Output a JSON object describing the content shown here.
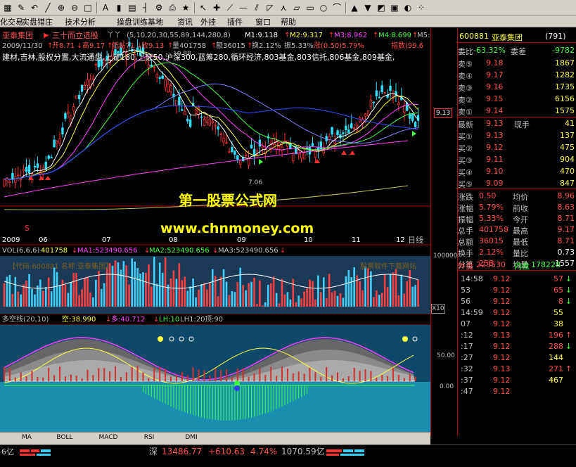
{
  "toolbar": {
    "icons": [
      "grid-icon",
      "pencil-icon",
      "back-icon",
      "line-icon",
      "zoom-in-icon",
      "zoom-out-icon",
      "square-icon",
      "text-icon",
      "bar-icon",
      "chart-icon",
      "ruler-icon",
      "gear-icon",
      "print-icon",
      "star-icon",
      "cursor-icon",
      "cross-icon",
      "ray-icon",
      "segment-icon",
      "parallel-icon",
      "fan-icon",
      "pitch-icon",
      "channel-icon",
      "rect-icon",
      "circle-icon",
      "arc-icon",
      "arrow-up-icon",
      "arrow-down-icon",
      "eraser-icon",
      "lock-icon",
      "palette-icon",
      "color-dots-icon"
    ]
  },
  "menu": [
    "化交易",
    "实盘猎庄",
    "技术分析",
    "操盘训练基地",
    "资讯",
    "外挂",
    "插件",
    "窗口",
    "帮助"
  ],
  "chart": {
    "stock_name": "亚泰集团",
    "formula_name": "三十而立选股",
    "formula_params": "(5,10,20,30,55,89,144,280,8)",
    "m1": "M1:9.118",
    "m2": "M2:9.317",
    "m3": "M3:8.962",
    "m4": "M4:8.699",
    "m5": "M5:",
    "date": "2009/11/30",
    "open": "开8.71",
    "high": "高9.17",
    "low": "低8.71",
    "close": "收9.13",
    "volume": "量401758",
    "amount": "额36015",
    "turnover": "换2.12%",
    "amplitude": "振5.33%",
    "change": "涨(0.50)5.79%",
    "index_label": "指数(99.6",
    "concepts": "建材,吉林,股权分置,大流通盘,上证180,上证50,沪深300,蓝筹280,循环经济,803基金,803信托,806基金,809基金,",
    "high_mark": "10.88",
    "low_mark": "7.06",
    "price_tag": "9.13",
    "s_mark": "S",
    "watermark_cn": "第一股票公式网",
    "watermark_url": "www.chnmoney.com",
    "period_label": "日线",
    "x_ticks": [
      "2009",
      "06",
      "07",
      "08",
      "09",
      "10",
      "11",
      "12"
    ],
    "vol_legend": "VOL(6,6,6)",
    "vol_value": "401758",
    "vol_ma1": "MA1:523490.656",
    "vol_ma2": "MA2:523490.656",
    "vol_ma3": "MA3:523490.656",
    "vol_axis_top": "100000",
    "vol_axis_unit": "X10",
    "vol_watermark_left": "【代码:600881  名称:亚泰集团】",
    "vol_watermark_right": "股票软件下载网站",
    "ind_legend": "多空线(20,10)",
    "ind_kong": "空:38.990",
    "ind_duo": "多:40.712",
    "ind_lh": "LH:10",
    "ind_lh1": "LH1:20",
    "ind_top": "顶:90",
    "ind_axis_50": "50.00",
    "ind_axis_0": "0.00"
  },
  "tabs": [
    "MA",
    "BOLL",
    "MACD",
    "RSI",
    "DMI"
  ],
  "side": {
    "code": "600881",
    "name": "亚泰集团",
    "rank": "(791)",
    "webi_label": "委比",
    "webi_value": "-63.32%",
    "weicha_label": "委差",
    "weicha_value": "-9782",
    "asks": [
      {
        "label": "卖⑤",
        "price": "9.18",
        "vol": "1867"
      },
      {
        "label": "卖④",
        "price": "9.17",
        "vol": "1282"
      },
      {
        "label": "卖③",
        "price": "9.16",
        "vol": "1735"
      },
      {
        "label": "卖②",
        "price": "9.15",
        "vol": "6156"
      },
      {
        "label": "卖①",
        "price": "9.14",
        "vol": "1575"
      }
    ],
    "last_label": "最新",
    "last_price": "9.13",
    "cur_label": "现手",
    "cur_value": "41",
    "bids": [
      {
        "label": "买①",
        "price": "9.13",
        "vol": "137"
      },
      {
        "label": "买②",
        "price": "9.12",
        "vol": "475"
      },
      {
        "label": "买③",
        "price": "9.11",
        "vol": "904"
      },
      {
        "label": "买④",
        "price": "9.10",
        "vol": "470"
      },
      {
        "label": "买⑤",
        "price": "9.09",
        "vol": "847"
      }
    ],
    "stats": [
      {
        "l1": "涨跌",
        "v1": "0.50",
        "l2": "均价",
        "v2": "8.96"
      },
      {
        "l1": "涨幅",
        "v1": "5.79%",
        "l2": "前收",
        "v2": "8.63"
      },
      {
        "l1": "振幅",
        "v1": "5.33%",
        "l2": "今开",
        "v2": "8.71"
      },
      {
        "l1": "总手",
        "v1": "401758",
        "l2": "最高",
        "v2": "9.17"
      },
      {
        "l1": "总额",
        "v1": "36015",
        "l2": "最低",
        "v2": "8.71"
      },
      {
        "l1": "换手",
        "v1": "2.12%",
        "l2": "量比",
        "v2": "0.73"
      },
      {
        "l1": "分笔",
        "v1": "258",
        "l2": "均量",
        "v2": "1557"
      }
    ],
    "waipan_label": "外盘",
    "waipan_value": "223530",
    "neipan_label": "内盘",
    "neipan_value": "178228",
    "ticks": [
      {
        "t": "14:58",
        "p": "9.12",
        "v": "57",
        "d": "down"
      },
      {
        "t": "53",
        "p": "9.12",
        "v": "65",
        "d": "down"
      },
      {
        "t": "56",
        "p": "9.12",
        "v": "8",
        "d": "down"
      },
      {
        "t": "14:59",
        "p": "9.12",
        "v": "55",
        "d": ""
      },
      {
        "t": "07",
        "p": "9.12",
        "v": "38",
        "d": ""
      },
      {
        "t": ":12",
        "p": "9.13",
        "v": "196",
        "d": "up"
      },
      {
        "t": ":17",
        "p": "9.12",
        "v": "288",
        "d": "down"
      },
      {
        "t": ":27",
        "p": "9.12",
        "v": "144",
        "d": ""
      },
      {
        "t": ":32",
        "p": "9.13",
        "v": "271",
        "d": "up"
      },
      {
        "t": ":37",
        "p": "9.12",
        "v": "467",
        "d": ""
      },
      {
        "t": ":47",
        "p": "9.12",
        "v": "",
        "d": ""
      }
    ]
  },
  "status": {
    "left_value": "6亿",
    "market": "深",
    "index_value": "13486.77",
    "change_value": "+610.63",
    "change_pct": "4.74%",
    "amount": "1070.59亿"
  }
}
